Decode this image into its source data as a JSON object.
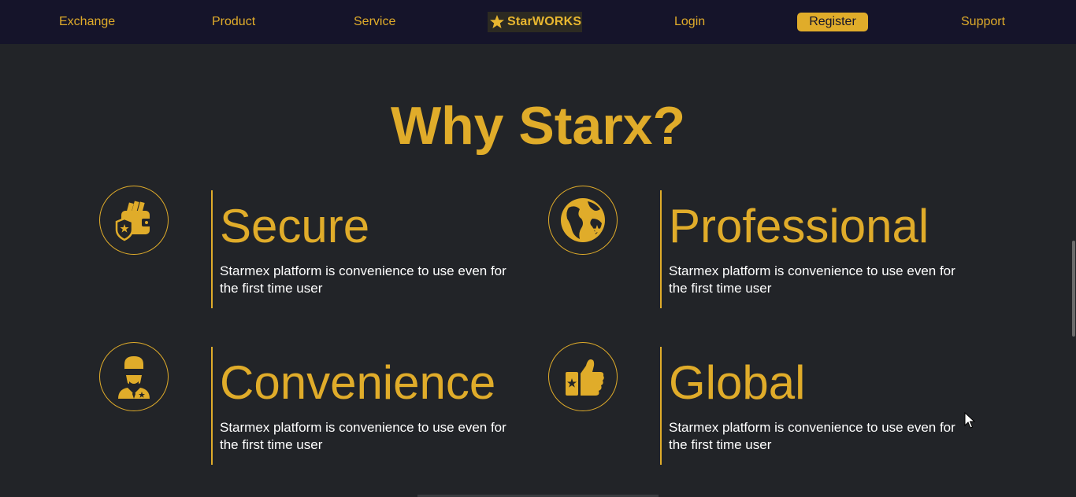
{
  "nav": {
    "items": [
      "Exchange",
      "Product",
      "Service",
      "Login",
      "Register",
      "Support"
    ],
    "logo_text": "StarWORKS",
    "logo_icon": "star-icon"
  },
  "section": {
    "title": "Why Starx?"
  },
  "features": [
    {
      "title": "Secure",
      "description": "Starmex platform is convenience to use even for the first time user",
      "icon": "wallet-shield-icon"
    },
    {
      "title": "Professional",
      "description": "Starmex platform is convenience to use even for the first time user",
      "icon": "globe-icon"
    },
    {
      "title": "Convenience",
      "description": "Starmex platform is convenience to use even for the first time user",
      "icon": "agent-icon"
    },
    {
      "title": "Global",
      "description": "Starmex platform is convenience to use even for the first time user",
      "icon": "thumbs-up-icon"
    }
  ],
  "colors": {
    "accent": "#e0ac2a",
    "nav_background": "#15142a",
    "page_background": "#222428",
    "text": "#ffffff"
  }
}
